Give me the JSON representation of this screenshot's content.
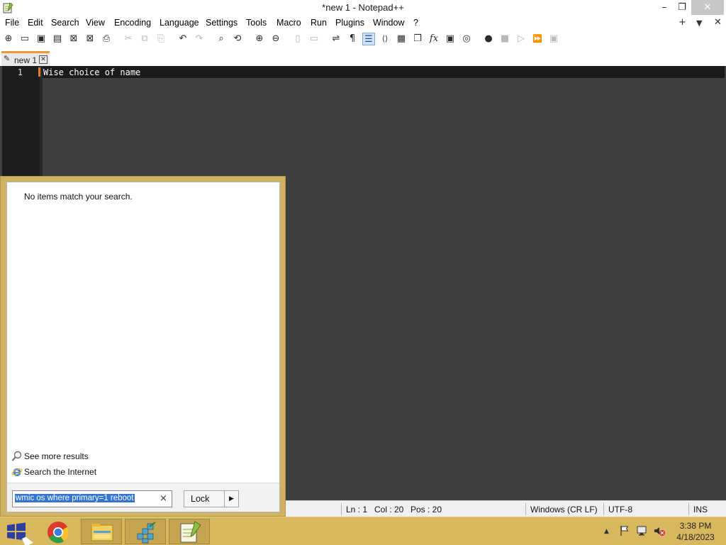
{
  "window": {
    "title": "*new 1 - Notepad++",
    "minimize_glyph": "–",
    "maximize_glyph": "❐",
    "close_glyph": "✕"
  },
  "menu": {
    "items": [
      "File",
      "Edit",
      "Search",
      "View",
      "Encoding",
      "Language",
      "Settings",
      "Tools",
      "Macro",
      "Run",
      "Plugins",
      "Window",
      "?"
    ],
    "right_plus": "+",
    "right_down": "▼",
    "right_close": "✕"
  },
  "toolbar": {
    "icons": [
      {
        "name": "new-file-icon",
        "glyph": "⊕",
        "enabled": true
      },
      {
        "name": "open-file-icon",
        "glyph": "▭",
        "enabled": true
      },
      {
        "name": "save-icon",
        "glyph": "▣",
        "enabled": true
      },
      {
        "name": "save-all-icon",
        "glyph": "▤",
        "enabled": true
      },
      {
        "name": "close-file-icon",
        "glyph": "⊠",
        "enabled": true
      },
      {
        "name": "close-all-icon",
        "glyph": "⊠",
        "enabled": true
      },
      {
        "name": "print-icon",
        "glyph": "⎙",
        "enabled": true
      },
      {
        "name": "cut-icon",
        "glyph": "✂",
        "enabled": false
      },
      {
        "name": "copy-icon",
        "glyph": "⧉",
        "enabled": false
      },
      {
        "name": "paste-icon",
        "glyph": "⎘",
        "enabled": false
      },
      {
        "name": "undo-icon",
        "glyph": "↶",
        "enabled": true
      },
      {
        "name": "redo-icon",
        "glyph": "↷",
        "enabled": false
      },
      {
        "name": "find-icon",
        "glyph": "⌕",
        "enabled": true
      },
      {
        "name": "replace-icon",
        "glyph": "⟲",
        "enabled": true
      },
      {
        "name": "zoom-in-icon",
        "glyph": "⊕",
        "enabled": true
      },
      {
        "name": "zoom-out-icon",
        "glyph": "⊖",
        "enabled": true
      },
      {
        "name": "sync-vertical-icon",
        "glyph": "▯",
        "enabled": false
      },
      {
        "name": "sync-horizontal-icon",
        "glyph": "▭",
        "enabled": false
      },
      {
        "name": "word-wrap-icon",
        "glyph": "⇌",
        "enabled": true
      },
      {
        "name": "show-all-chars-icon",
        "glyph": "¶",
        "enabled": true
      },
      {
        "name": "indent-guide-icon",
        "glyph": "☰",
        "enabled": true,
        "active": true
      },
      {
        "name": "xml-tag-icon",
        "glyph": "⟨⟩",
        "enabled": true
      },
      {
        "name": "document-map-icon",
        "glyph": "▦",
        "enabled": true
      },
      {
        "name": "document-list-icon",
        "glyph": "❐",
        "enabled": true
      },
      {
        "name": "function-list-icon",
        "glyph": "fx",
        "enabled": true
      },
      {
        "name": "folder-workspace-icon",
        "glyph": "▣",
        "enabled": true
      },
      {
        "name": "monitoring-icon",
        "glyph": "◎",
        "enabled": true
      },
      {
        "name": "record-macro-icon",
        "glyph": "●",
        "enabled": true
      },
      {
        "name": "stop-macro-icon",
        "glyph": "■",
        "enabled": false
      },
      {
        "name": "play-macro-icon",
        "glyph": "▷",
        "enabled": false
      },
      {
        "name": "run-macro-multiple-icon",
        "glyph": "⏩",
        "enabled": true
      },
      {
        "name": "save-macro-icon",
        "glyph": "▣",
        "enabled": false
      }
    ]
  },
  "tabs": [
    {
      "label": "new 1",
      "close_glyph": "✕"
    }
  ],
  "editor": {
    "line_number": "1",
    "line_text": "Wise choice of name"
  },
  "statusbar": {
    "ln": "Ln : 1",
    "col": "Col : 20",
    "pos": "Pos : 20",
    "eol": "Windows (CR LF)",
    "encoding": "UTF-8",
    "mode": "INS"
  },
  "search_panel": {
    "message": "No items match your search.",
    "see_more": "See more results",
    "search_internet": "Search the Internet",
    "query": "wmic os where primary=1 reboot",
    "clear_glyph": "×",
    "lock_label": "Lock",
    "lock_arrow": "▶"
  },
  "taskbar": {
    "apps": [
      "chrome-icon",
      "file-explorer-icon",
      "network-app-icon",
      "notepadpp-icon"
    ],
    "time": "3:38 PM",
    "date": "4/18/2023",
    "tray_up_glyph": "▲"
  }
}
